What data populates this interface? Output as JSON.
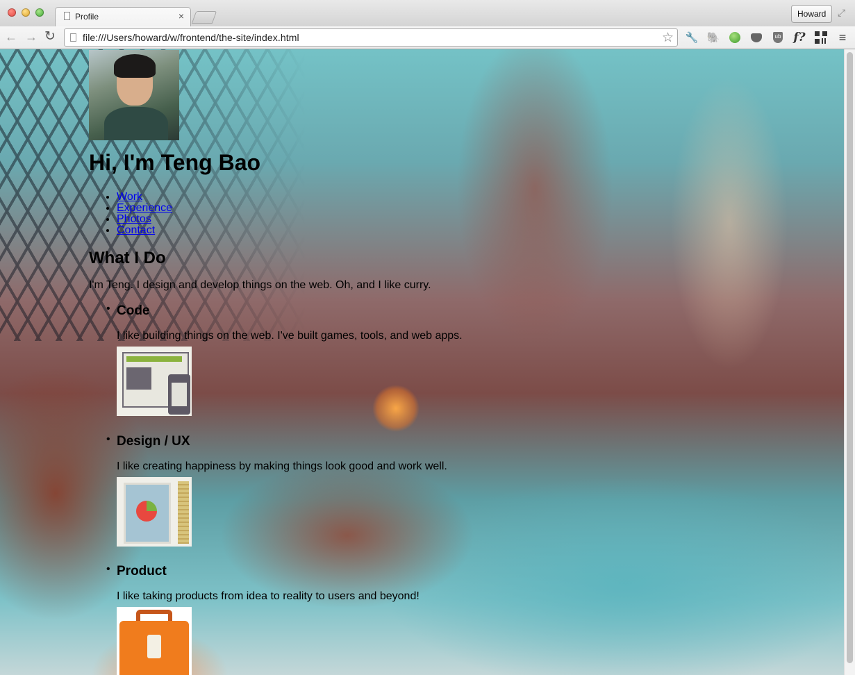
{
  "browser": {
    "tab_title": "Profile",
    "tab_close": "×",
    "profile_name": "Howard",
    "url": "file:///Users/howard/w/frontend/the-site/index.html",
    "icons": [
      "back-arrow-icon",
      "forward-arrow-icon",
      "reload-icon",
      "bookmark-star-icon",
      "wrench-icon",
      "evernote-icon",
      "globe-icon",
      "pocket-icon",
      "ublock-icon",
      "font-finder-icon",
      "qr-code-icon",
      "hamburger-menu-icon"
    ]
  },
  "page": {
    "title": "Hi, I'm Teng Bao",
    "nav": [
      "Work",
      "Experience",
      "Photos",
      "Contact"
    ],
    "section_heading": "What I Do",
    "intro": "I'm Teng. I design and develop things on the web. Oh, and I like curry.",
    "skills": [
      {
        "title": "Code",
        "description": "I like building things on the web. I've built games, tools, and web apps.",
        "icon": "devices-icon"
      },
      {
        "title": "Design / UX",
        "description": "I like creating happiness by making things look good and work well.",
        "icon": "design-document-icon"
      },
      {
        "title": "Product",
        "description": "I like taking products from idea to reality to users and beyond!",
        "icon": "briefcase-icon"
      }
    ]
  }
}
